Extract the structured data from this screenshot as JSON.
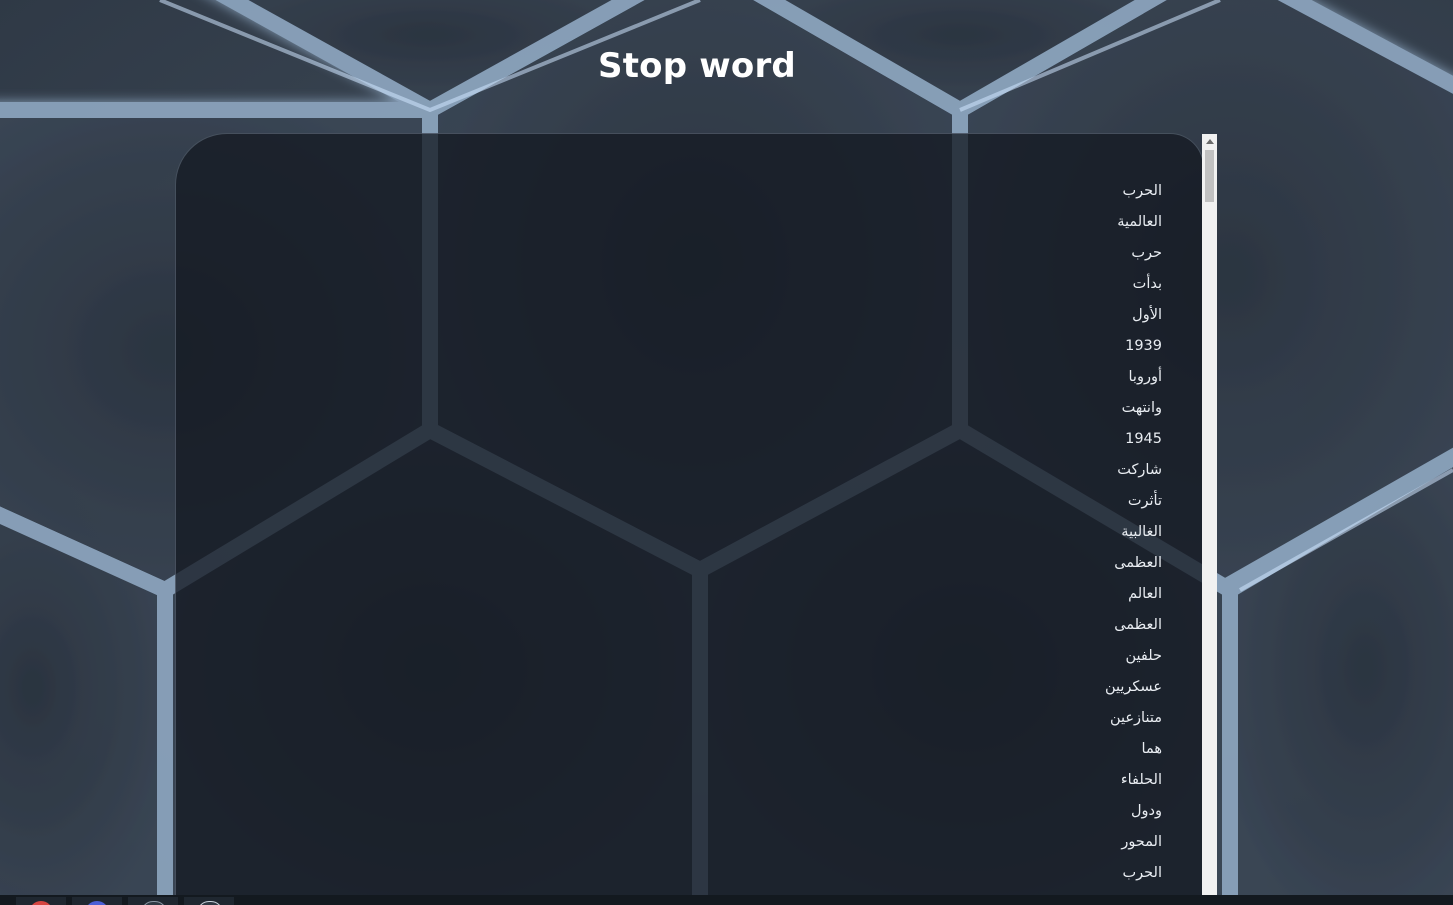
{
  "page": {
    "title": "Stop word"
  },
  "words": [
    "الحرب",
    "العالمية",
    "حرب",
    "بدأت",
    "الأول",
    "1939",
    "أوروبا",
    "وانتهت",
    "1945",
    "شاركت",
    "تأثرت",
    "الغالبية",
    "العظمى",
    "العالم",
    "العظمى",
    "حلفين",
    "عسكريين",
    "متنازعين",
    "هما",
    "الحلفاء",
    "ودول",
    "المحور",
    "الحرب"
  ],
  "taskbar": {
    "apps": [
      "chrome-icon",
      "app-icon",
      "window-icon",
      "window-icon"
    ]
  },
  "colors": {
    "background": "#3a4656",
    "hex_glow": "#a9d4ff",
    "panel": "#141a22",
    "text": "#e8ecf1"
  }
}
